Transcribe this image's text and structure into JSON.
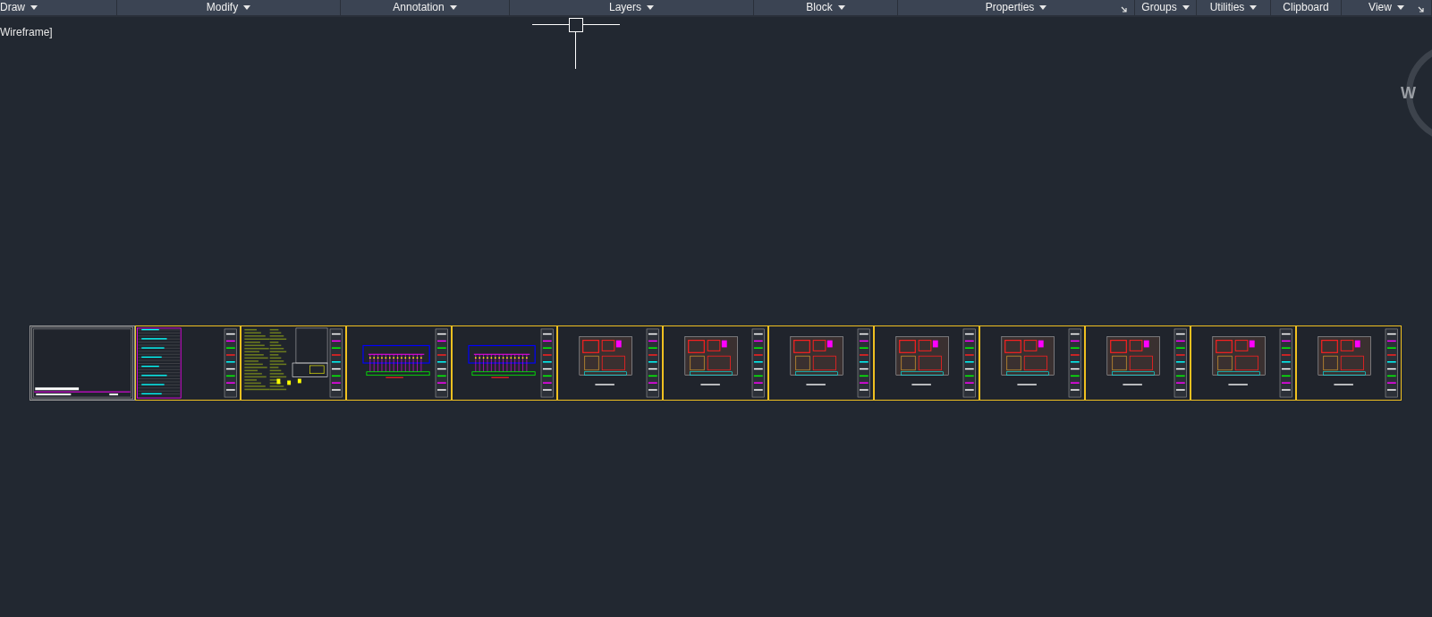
{
  "ribbon_panels": [
    {
      "label": "Draw",
      "dropdown": true,
      "launcher": false
    },
    {
      "label": "Modify",
      "dropdown": true,
      "launcher": false
    },
    {
      "label": "Annotation",
      "dropdown": true,
      "launcher": false
    },
    {
      "label": "Layers",
      "dropdown": true,
      "launcher": false
    },
    {
      "label": "Block",
      "dropdown": true,
      "launcher": false
    },
    {
      "label": "Properties",
      "dropdown": true,
      "launcher": true
    },
    {
      "label": "Groups",
      "dropdown": true,
      "launcher": false
    },
    {
      "label": "Utilities",
      "dropdown": true,
      "launcher": false
    },
    {
      "label": "Clipboard",
      "dropdown": false,
      "launcher": false
    },
    {
      "label": "View",
      "dropdown": true,
      "launcher": true
    }
  ],
  "viewport": {
    "visual_style": "Wireframe]",
    "viewcube_label": "W"
  },
  "sheets": [
    {
      "kind": "cover"
    },
    {
      "kind": "table"
    },
    {
      "kind": "notes"
    },
    {
      "kind": "schematic"
    },
    {
      "kind": "schematic"
    },
    {
      "kind": "floorplan"
    },
    {
      "kind": "floorplan"
    },
    {
      "kind": "floorplan"
    },
    {
      "kind": "floorplan"
    },
    {
      "kind": "floorplan"
    },
    {
      "kind": "floorplan"
    },
    {
      "kind": "floorplan"
    },
    {
      "kind": "floorplan"
    }
  ]
}
